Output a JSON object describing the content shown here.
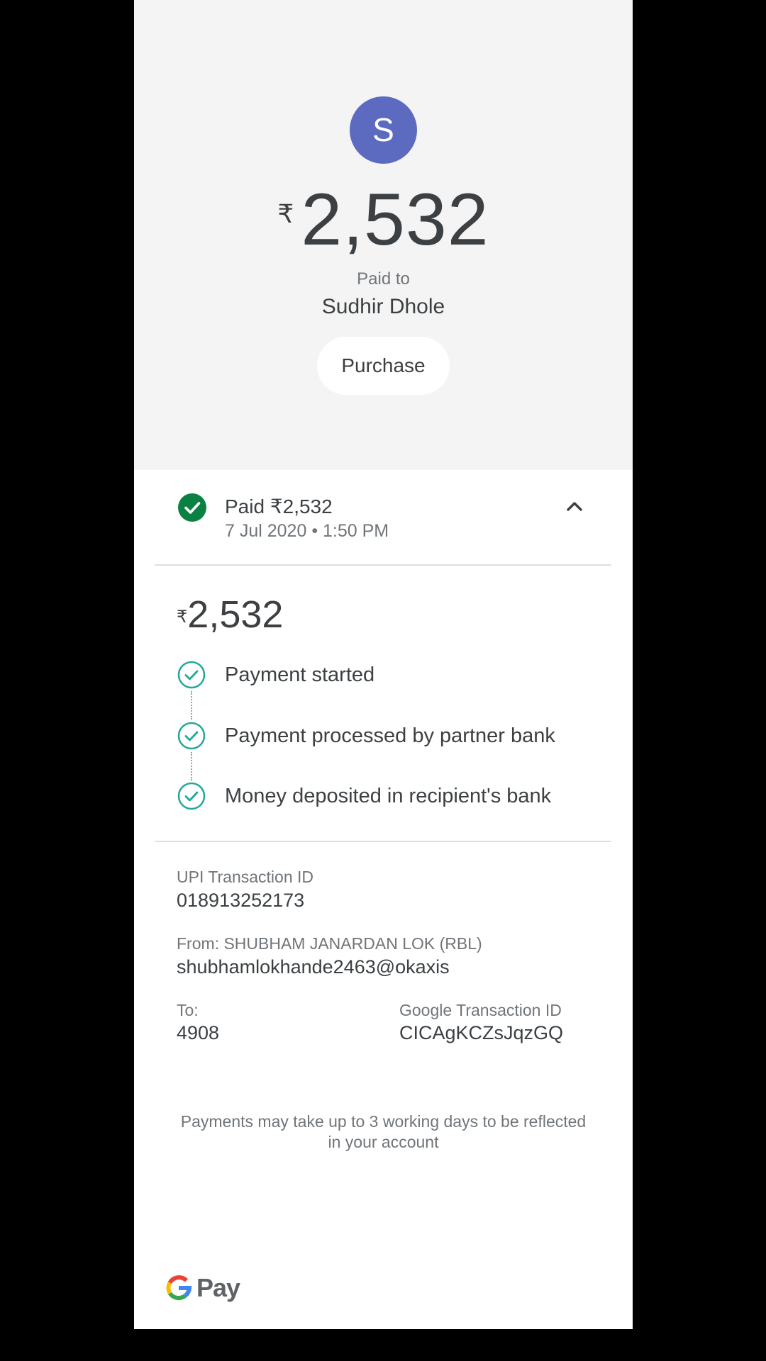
{
  "header": {
    "avatar_initial": "S",
    "currency_symbol": "₹",
    "amount": "2,532",
    "paid_to_label": "Paid to",
    "payee_name": "Sudhir Dhole",
    "category_chip": "Purchase"
  },
  "status": {
    "title": "Paid ₹2,532",
    "date": "7 Jul 2020 • 1:50 PM",
    "icon": "check-circle-filled-icon",
    "expand_icon": "chevron-up-icon"
  },
  "details": {
    "currency_symbol": "₹",
    "amount": "2,532",
    "steps": [
      {
        "label": "Payment started",
        "icon": "check-circle-outline-icon"
      },
      {
        "label": "Payment processed by partner bank",
        "icon": "check-circle-outline-icon"
      },
      {
        "label": "Money deposited in recipient's bank",
        "icon": "check-circle-outline-icon"
      }
    ]
  },
  "transaction": {
    "upi_label": "UPI Transaction ID",
    "upi_id": "018913252173",
    "from_label": "From: SHUBHAM JANARDAN LOK (RBL)",
    "from_value": "shubhamlokhande2463@okaxis",
    "to_label": "To:",
    "to_value": "4908",
    "google_label": "Google Transaction ID",
    "google_id": "CICAgKCZsJqzGQ"
  },
  "footer": {
    "note": "Payments may take up to 3 working days to be reflected in your account",
    "brand_text": "Pay"
  },
  "colors": {
    "avatar": "#5c6bc0",
    "success": "#0b8043",
    "step_check": "#26a69a",
    "text_primary": "#3c4043",
    "text_secondary": "#70757a"
  }
}
